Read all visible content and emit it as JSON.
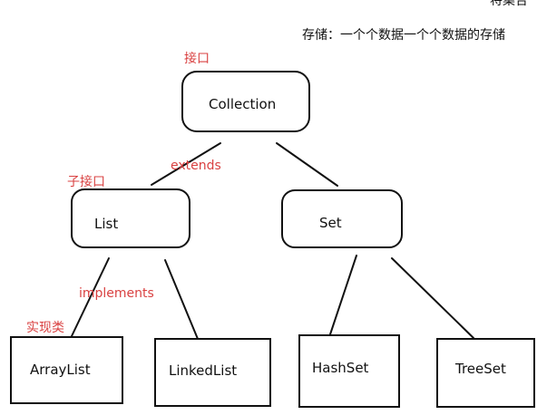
{
  "header": {
    "corner_text": "将集合",
    "storage_note": "存储：一个个数据一个个数据的存储"
  },
  "nodes": {
    "collection": "Collection",
    "list": "List",
    "set": "Set",
    "arraylist": "ArrayList",
    "linkedlist": "LinkedList",
    "hashset": "HashSet",
    "treeset": "TreeSet"
  },
  "annotations": {
    "interface": "接口",
    "sub_interface": "子接口",
    "impl_class": "实现类",
    "extends": "extends",
    "implements": "implements"
  },
  "colors": {
    "stroke": "#111111",
    "annotation": "#d94141",
    "background": "#ffffff"
  }
}
